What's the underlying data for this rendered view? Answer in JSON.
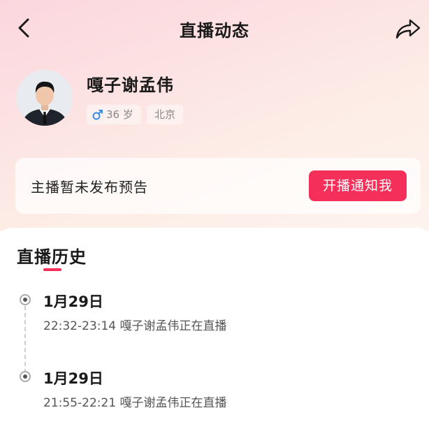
{
  "header": {
    "title": "直播动态",
    "back_icon": "chevron-left-icon",
    "share_icon": "share-icon"
  },
  "profile": {
    "name": "嘎子谢孟伟",
    "gender_icon": "male-icon",
    "age": "36 岁",
    "city": "北京"
  },
  "notice": {
    "text": "主播暂未发布预告",
    "button_label": "开播通知我"
  },
  "history": {
    "title": "直播历史",
    "entries": [
      {
        "date": "1月29日",
        "desc": "22:32-23:14 嘎子谢孟伟正在直播"
      },
      {
        "date": "1月29日",
        "desc": "21:55-22:21 嘎子谢孟伟正在直播"
      }
    ]
  },
  "colors": {
    "accent": "#f4305a",
    "male": "#3a8ee6"
  }
}
